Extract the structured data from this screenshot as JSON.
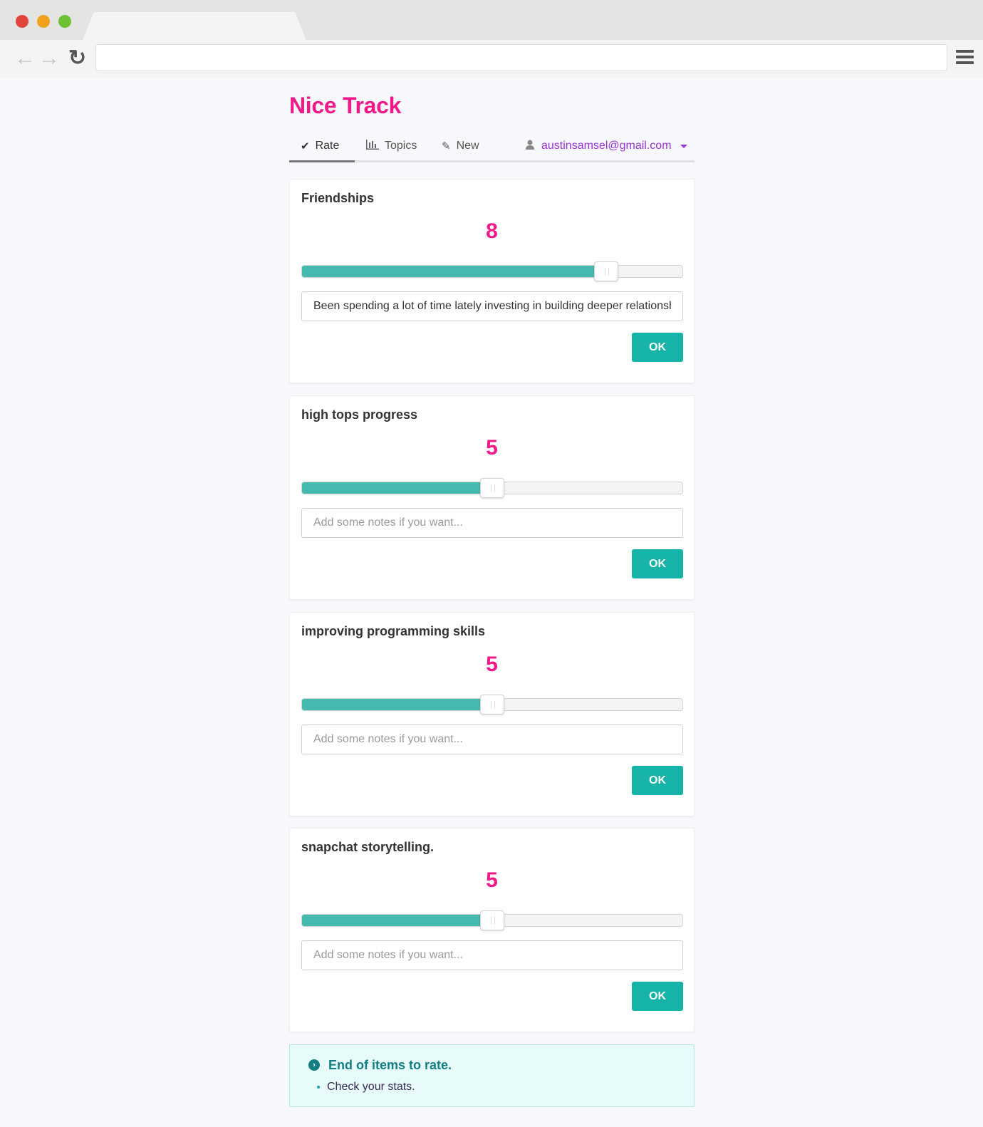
{
  "app": {
    "title": "Nice Track"
  },
  "nav": {
    "items": [
      {
        "label": "Rate",
        "icon": "checkmark-icon",
        "active": true
      },
      {
        "label": "Topics",
        "icon": "bar-chart-icon",
        "active": false
      },
      {
        "label": "New",
        "icon": "pencil-icon",
        "active": false
      }
    ],
    "user_email": "austinsamsel@gmail.com"
  },
  "cards": [
    {
      "title": "Friendships",
      "rating": "8",
      "rating_fraction": 0.8,
      "notes_value": "Been spending a lot of time lately investing in building deeper relationships",
      "notes_placeholder": "Add some notes if you want...",
      "ok_label": "OK"
    },
    {
      "title": "high tops progress",
      "rating": "5",
      "rating_fraction": 0.5,
      "notes_value": "",
      "notes_placeholder": "Add some notes if you want...",
      "ok_label": "OK"
    },
    {
      "title": "improving programming skills",
      "rating": "5",
      "rating_fraction": 0.5,
      "notes_value": "",
      "notes_placeholder": "Add some notes if you want...",
      "ok_label": "OK"
    },
    {
      "title": "snapchat storytelling.",
      "rating": "5",
      "rating_fraction": 0.5,
      "notes_value": "",
      "notes_placeholder": "Add some notes if you want...",
      "ok_label": "OK"
    }
  ],
  "end_message": {
    "title": "End of items to rate.",
    "link": "Check your stats."
  },
  "colors": {
    "brand": "#f0198a",
    "accent": "#16b3a8",
    "slider_fill": "#44b9ae",
    "user_link": "#9b30d9"
  }
}
